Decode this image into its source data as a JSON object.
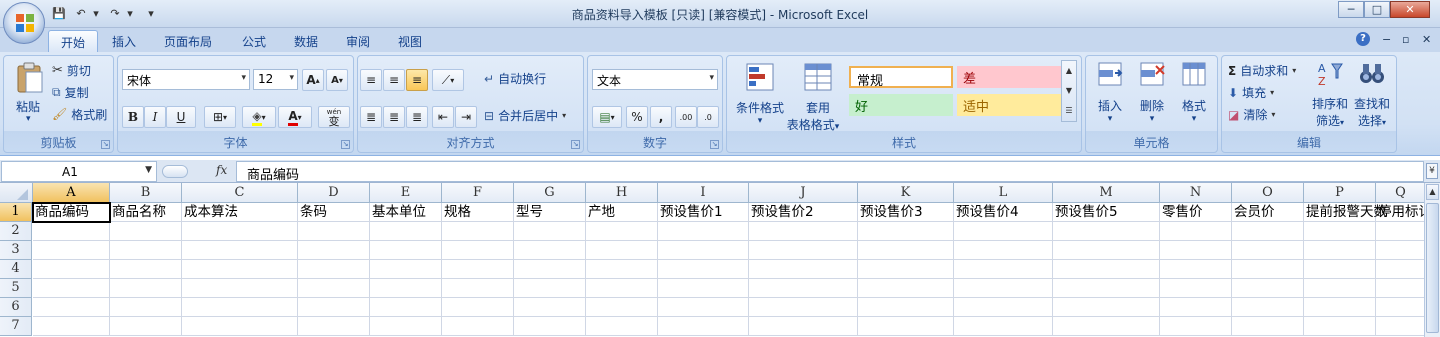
{
  "window": {
    "title": "商品资料导入模板 [只读] [兼容模式] - Microsoft Excel",
    "min": "─",
    "max": "□",
    "close": "✕"
  },
  "qat": {
    "save": "💾",
    "undo": "↶",
    "redo": "↷",
    "customize": "▾"
  },
  "tabs": [
    {
      "label": "开始",
      "active": true
    },
    {
      "label": "插入"
    },
    {
      "label": "页面布局"
    },
    {
      "label": "公式"
    },
    {
      "label": "数据"
    },
    {
      "label": "审阅"
    },
    {
      "label": "视图"
    }
  ],
  "ribbon_controls": {
    "help": "?",
    "min": "−",
    "restore": "▫",
    "close": "✕"
  },
  "clipboard": {
    "label": "剪贴板",
    "paste": "粘贴",
    "cut": "剪切",
    "copy": "复制",
    "format_painter": "格式刷"
  },
  "font": {
    "label": "字体",
    "family": "宋体",
    "size": "12",
    "grow": "A",
    "shrink": "A",
    "bold": "B",
    "italic": "I",
    "underline": "U",
    "phonetic": "wén",
    "phonetic2": "变"
  },
  "alignment": {
    "label": "对齐方式",
    "wrap": "自动换行",
    "merge": "合并后居中"
  },
  "number": {
    "label": "数字",
    "format": "文本",
    "percent": "%",
    "comma": ",",
    "inc_decimal": ".00",
    "dec_decimal": ".0"
  },
  "styles": {
    "label": "样式",
    "conditional": "条件格式",
    "table_format_1": "套用",
    "table_format_2": "表格格式",
    "cells": [
      {
        "name": "常规",
        "bg": "#ffffff",
        "fg": "#000000"
      },
      {
        "name": "差",
        "bg": "#ffc7ce",
        "fg": "#9c0006"
      },
      {
        "name": "好",
        "bg": "#c6efce",
        "fg": "#006100"
      },
      {
        "name": "适中",
        "bg": "#ffeb9c",
        "fg": "#9c6500"
      }
    ]
  },
  "cells_group": {
    "label": "单元格",
    "insert": "插入",
    "delete": "删除",
    "format": "格式"
  },
  "editing": {
    "label": "编辑",
    "autosum": "自动求和",
    "fill": "填充",
    "clear": "清除",
    "sort_1": "排序和",
    "sort_2": "筛选",
    "find_1": "查找和",
    "find_2": "选择"
  },
  "formula_bar": {
    "name_box": "A1",
    "fx": "fx",
    "content": "商品编码"
  },
  "sheet": {
    "columns": [
      "A",
      "B",
      "C",
      "D",
      "E",
      "F",
      "G",
      "H",
      "I",
      "J",
      "K",
      "L",
      "M",
      "N",
      "O",
      "P",
      "Q"
    ],
    "rows": [
      "1",
      "2",
      "3",
      "4",
      "5",
      "6",
      "7"
    ],
    "row1": [
      "商品编码",
      "商品名称",
      "成本算法",
      "条码",
      "基本单位",
      "规格",
      "型号",
      "产地",
      "预设售价1",
      "预设售价2",
      "预设售价3",
      "预设售价4",
      "预设售价5",
      "零售价",
      "会员价",
      "提前报警天数",
      "停用标记"
    ],
    "active_cell": "A1"
  }
}
